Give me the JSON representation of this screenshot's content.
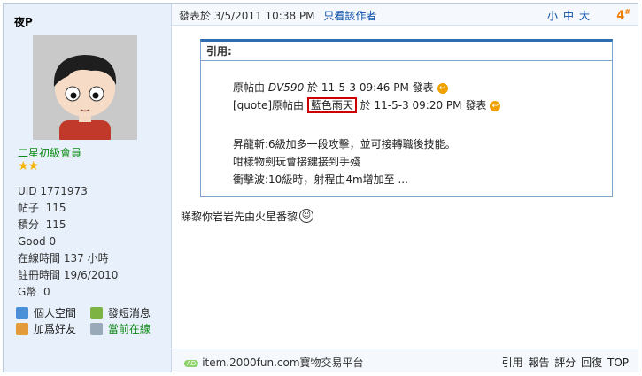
{
  "user": {
    "name": "夜P",
    "rank": "二星初級會員",
    "stars": "★★",
    "stats": [
      {
        "label": "UID",
        "value": "1771973"
      },
      {
        "label": "帖子",
        "value": "115"
      },
      {
        "label": "積分",
        "value": "115"
      },
      {
        "label": "Good",
        "value": "0"
      },
      {
        "label": "在線時間",
        "value": "137 小時"
      },
      {
        "label": "註冊時間",
        "value": "19/6/2010"
      },
      {
        "label": "G幣",
        "value": "0"
      }
    ],
    "links": {
      "space": "個人空間",
      "message": "發短消息",
      "add_friend": "加爲好友",
      "online": "當前在線"
    }
  },
  "post": {
    "posted_at": "發表於 3/5/2011 10:38 PM",
    "only_author": "只看該作者",
    "font_sizes": "小中大",
    "floor": "4",
    "floor_suffix": "#",
    "quote": {
      "title": "引用:",
      "line1_prefix": "原帖由",
      "line1_user": "DV590",
      "line1_suffix": "於 11-5-3 09:46 PM 發表",
      "line2_prefix": "[quote]原帖由",
      "line2_user": "藍色雨天",
      "line2_suffix": "於 11-5-3 09:20 PM 發表",
      "body": [
        "昇龍斬:6級加多一段攻擊，並可接轉職後技能。",
        "咁樣物劍玩會接鍵接到手殘",
        "衝擊波:10級時，射程由4m增加至 ..."
      ]
    },
    "reply": "睇黎你岩岩先由火星番黎"
  },
  "footer": {
    "ad_badge": "AD",
    "ad_text": "item.2000fun.com寶物交易平台",
    "actions": [
      "引用",
      "報告",
      "評分",
      "回復",
      "TOP"
    ]
  }
}
